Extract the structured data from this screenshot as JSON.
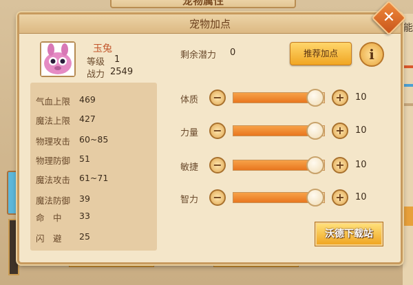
{
  "background": {
    "top_title": "宠物属性",
    "right_char": "能"
  },
  "dialog": {
    "title": "宠物加点",
    "close_icon": "close-icon"
  },
  "pet": {
    "name": "玉兔",
    "level_label": "等级",
    "level_value": "1",
    "power_label": "战力",
    "power_value": "2549"
  },
  "stats": [
    {
      "label": "气血上限",
      "value": "469"
    },
    {
      "label": "魔法上限",
      "value": "427"
    },
    {
      "label": "物理攻击",
      "value": "60~85"
    },
    {
      "label": "物理防御",
      "value": "51"
    },
    {
      "label": "魔法攻击",
      "value": "61~71"
    },
    {
      "label": "魔法防御",
      "value": "39"
    },
    {
      "label": "命　中",
      "value": "33"
    },
    {
      "label": "闪　避",
      "value": "25"
    }
  ],
  "potential": {
    "label": "剩余潜力",
    "value": "0"
  },
  "recommend_button": "推荐加点",
  "info_button": "i",
  "attributes": [
    {
      "label": "体质",
      "value": "10",
      "level": 0.9
    },
    {
      "label": "力量",
      "value": "10",
      "level": 0.9
    },
    {
      "label": "敏捷",
      "value": "10",
      "level": 0.9
    },
    {
      "label": "智力",
      "value": "10",
      "level": 0.9
    }
  ],
  "minus_symbol": "−",
  "plus_symbol": "+",
  "confirm_button": "沃德下载站",
  "colors": {
    "accent": "#f0a623",
    "slider_fill": "#e8761f",
    "name": "#c2552b"
  }
}
